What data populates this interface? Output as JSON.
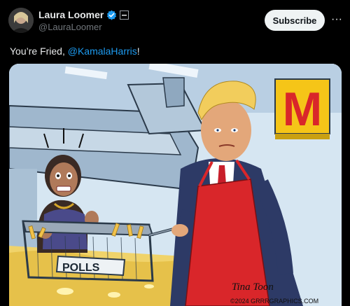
{
  "author": {
    "display_name": "Laura Loomer",
    "handle": "@LauraLoomer"
  },
  "actions": {
    "subscribe_label": "Subscribe",
    "more_label": "···"
  },
  "tweet": {
    "text_before": "You’re Fried, ",
    "mention": "@KamalaHarris",
    "text_after": "!"
  },
  "image": {
    "sign_letter": "M",
    "basket_label": "POLLS",
    "signature": "Tina Toon",
    "copyright": "©2024 GRRRGRAPHICS.COM"
  },
  "colors": {
    "verified": "#1d9bf0",
    "link": "#1d9bf0",
    "apron": "#d9262a",
    "sign": "#f5c518"
  }
}
